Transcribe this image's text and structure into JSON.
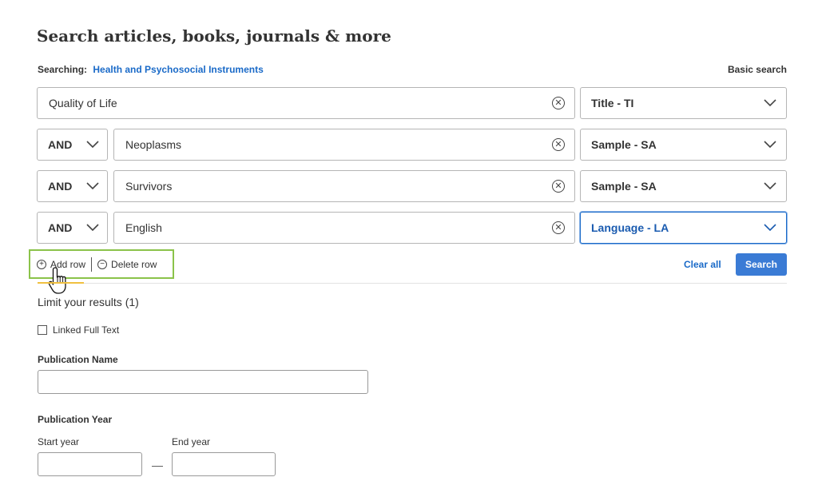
{
  "header": {
    "title": "Search articles, books, journals & more",
    "searching_label": "Searching:",
    "database": "Health and Psychosocial Instruments",
    "basic_search": "Basic search"
  },
  "rows": [
    {
      "operator": "",
      "term": "Quality of Life",
      "field": "Title - TI",
      "active": false
    },
    {
      "operator": "AND",
      "term": "Neoplasms",
      "field": "Sample - SA",
      "active": false
    },
    {
      "operator": "AND",
      "term": "Survivors",
      "field": "Sample - SA",
      "active": false
    },
    {
      "operator": "AND",
      "term": "English",
      "field": "Language - LA",
      "active": true
    }
  ],
  "row_actions": {
    "add_row": "Add row",
    "delete_row": "Delete row"
  },
  "actions": {
    "clear_all": "Clear all",
    "search": "Search"
  },
  "limits": {
    "title": "Limit your results (1)",
    "linked_full_text": "Linked Full Text",
    "linked_full_text_checked": false,
    "publication_name_label": "Publication Name",
    "publication_name_value": "",
    "publication_year_label": "Publication Year",
    "start_year_label": "Start year",
    "start_year_value": "",
    "end_year_label": "End year",
    "end_year_value": "",
    "range_separator": "—"
  },
  "icons": {
    "clear": "clear-circle-x-icon",
    "chevron": "chevron-down-icon",
    "add": "plus-circle-icon",
    "delete": "minus-circle-icon",
    "cursor": "hand-pointer-icon"
  },
  "colors": {
    "link": "#1a6ac8",
    "search_button": "#3a7bd5",
    "highlight": "#8bc34a",
    "active_border": "#1a6ac8"
  }
}
